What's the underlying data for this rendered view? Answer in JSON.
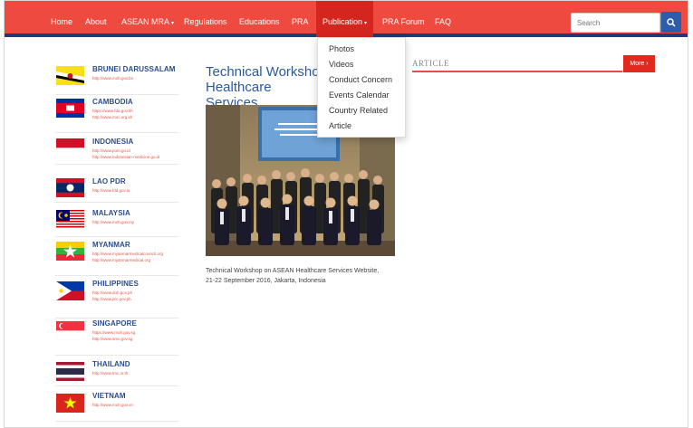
{
  "nav": {
    "items": [
      "Home",
      "About",
      "ASEAN MRA",
      "Regulations",
      "Educations",
      "PRA",
      "Publication",
      "PRA Forum",
      "FAQ"
    ],
    "search_placeholder": "Search"
  },
  "dropdown": {
    "items": [
      "Photos",
      "Videos",
      "Conduct Concern",
      "Events Calendar",
      "Country Related",
      "Article"
    ]
  },
  "countries": [
    {
      "name": "BRUNEI DARUSSALAM",
      "links": [
        "http://www.moh.gov.bn"
      ]
    },
    {
      "name": "CAMBODIA",
      "links": [
        "https://www.fda.gov.kh",
        "http://www.moc.org.kh"
      ]
    },
    {
      "name": "INDONESIA",
      "links": [
        "http://www.pom.go.id",
        "http://www.indonesian-medicine.go.id"
      ]
    },
    {
      "name": "LAO PDR",
      "links": [
        "http://www.fdd.gov.la"
      ]
    },
    {
      "name": "MALAYSIA",
      "links": [
        "http://www.moh.gov.my"
      ]
    },
    {
      "name": "MYANMAR",
      "links": [
        "http://www.myanmarmedicalcouncil.org",
        "http://www.myanmarmedical.org"
      ]
    },
    {
      "name": "PHILIPPINES",
      "links": [
        "http://www.doh.gov.ph",
        "http://www.prc.gov.ph"
      ]
    },
    {
      "name": "SINGAPORE",
      "links": [
        "https://www.moh.gov.sg",
        "http://www.smc.gov.sg"
      ]
    },
    {
      "name": "THAILAND",
      "links": [
        "http://www.tmc.or.th"
      ]
    },
    {
      "name": "VIETNAM",
      "links": [
        "http://www.moh.gov.vn"
      ]
    }
  ],
  "main": {
    "title": "Technical Workshop on ASEAN Healthcare Services Website",
    "title_visible_line1": "Technical Worksho",
    "title_visible_line2": "Healthcare Services",
    "caption_line1": "Technical Workshop on ASEAN Healthcare Services Website,",
    "caption_line2": "21-22 September 2016, Jakarta, Indonesia"
  },
  "article": {
    "heading": "ARTICLE",
    "more_label": "More ›"
  },
  "colors": {
    "nav_bg": "#ef4a40",
    "nav_border": "#1f3a78",
    "accent_red": "#e02a20",
    "title_blue": "#2b5a9b",
    "search_btn": "#2d5da8"
  },
  "icons": {
    "search": "search-icon",
    "caret": "chevron-down-icon"
  }
}
